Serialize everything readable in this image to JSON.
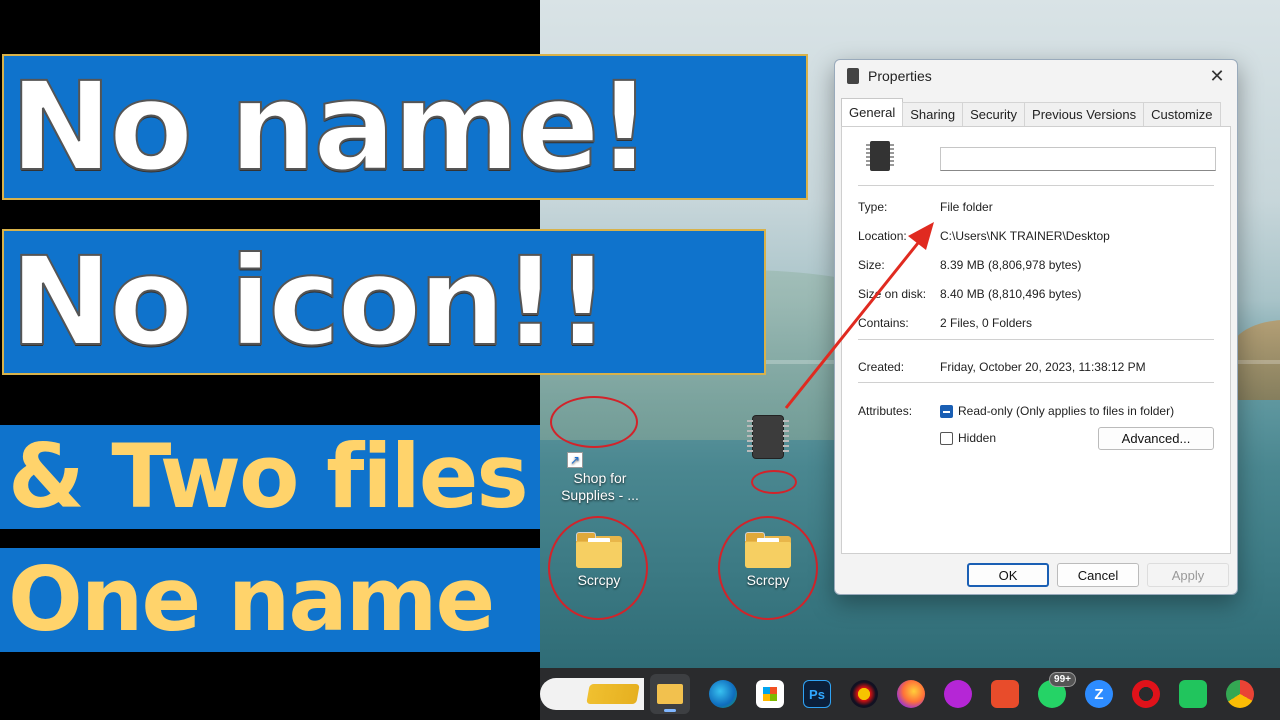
{
  "banners": {
    "line1": "No name!",
    "line2": "No icon!!",
    "line3": "& Two files",
    "line4": "One name"
  },
  "desktop": {
    "shortcut_label_1": "Shop for",
    "shortcut_label_2": "Supplies - ...",
    "folder1_label": "Scrcpy",
    "folder2_label": "Scrcpy"
  },
  "dialog": {
    "title": "Properties",
    "close_glyph": "✕",
    "tabs": [
      "General",
      "Sharing",
      "Security",
      "Previous Versions",
      "Customize"
    ],
    "name_value": "",
    "rows": {
      "type": {
        "label": "Type:",
        "value": "File folder"
      },
      "location": {
        "label": "Location:",
        "value": "C:\\Users\\NK TRAINER\\Desktop"
      },
      "size": {
        "label": "Size:",
        "value": "8.39 MB (8,806,978 bytes)"
      },
      "size_on_disk": {
        "label": "Size on disk:",
        "value": "8.40 MB (8,810,496 bytes)"
      },
      "contains": {
        "label": "Contains:",
        "value": "2 Files, 0 Folders"
      },
      "created": {
        "label": "Created:",
        "value": "Friday, October 20, 2023, 11:38:12 PM"
      }
    },
    "attributes_label": "Attributes:",
    "readonly_label": "Read-only (Only applies to files in folder)",
    "hidden_label": "Hidden",
    "advanced_button": "Advanced...",
    "ok_button": "OK",
    "cancel_button": "Cancel",
    "apply_button": "Apply"
  },
  "taskbar": {
    "whatsapp_badge": "99+",
    "ps_label": "Ps",
    "zoom_label": "Z",
    "colors": {
      "bg": "#2a2b2d",
      "accent": "#7fb6ff"
    }
  },
  "colors": {
    "banner_blue": "#0f73cc",
    "banner_yellow_text": "#ffd36b",
    "ring_red": "#d2232a"
  }
}
